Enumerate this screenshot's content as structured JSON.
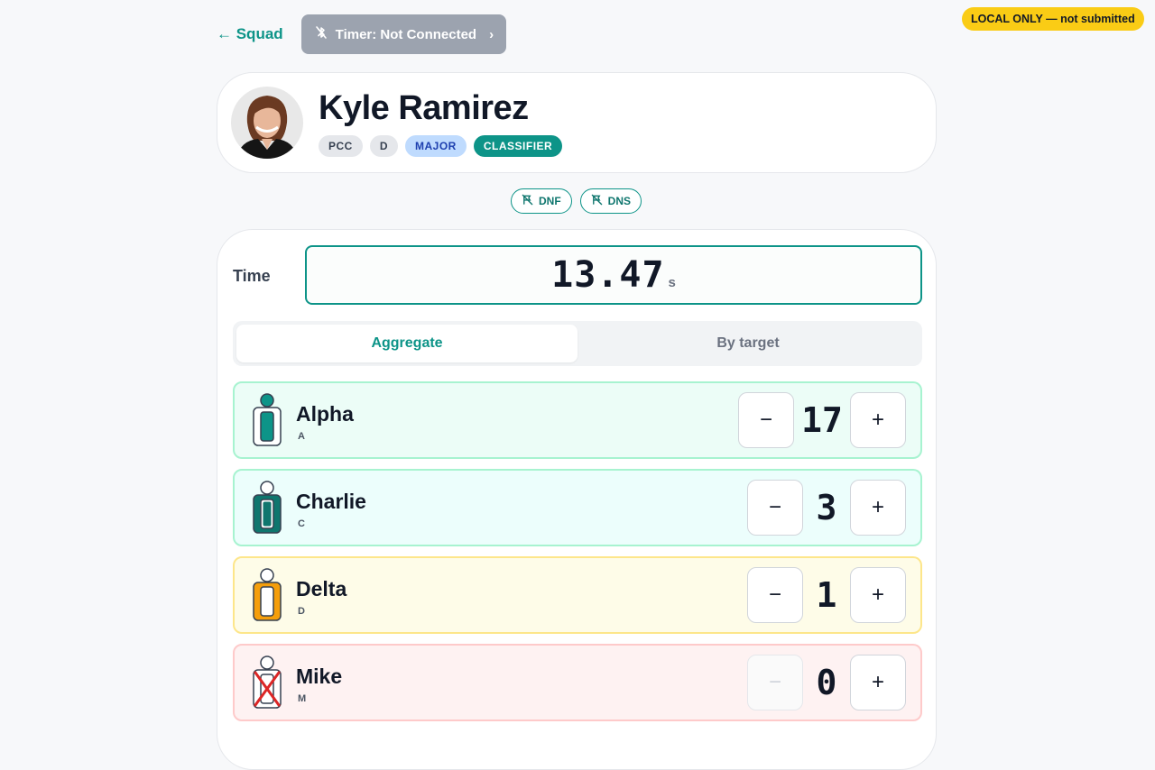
{
  "header": {
    "back_label": "← Squad",
    "timer_label": "Timer: Not Connected",
    "local_badge": "LOCAL ONLY — not submitted"
  },
  "shooter": {
    "name": "Kyle Ramirez",
    "tags": [
      "PCC",
      "D",
      "MAJOR",
      "CLASSIFIER"
    ]
  },
  "flags": {
    "dnf": "DNF",
    "dns": "DNS"
  },
  "time": {
    "label": "Time",
    "value": "13.47",
    "unit": "s"
  },
  "modes": {
    "aggregate": "Aggregate",
    "by_target": "By target",
    "active": "Aggregate"
  },
  "zones": [
    {
      "name": "Alpha",
      "code": "A",
      "count": "17",
      "color": "#0d9488"
    },
    {
      "name": "Charlie",
      "code": "C",
      "count": "3",
      "color": "#0f766e"
    },
    {
      "name": "Delta",
      "code": "D",
      "count": "1",
      "color": "#f59e0b"
    },
    {
      "name": "Mike",
      "code": "M",
      "count": "0",
      "color": "#dc2626"
    }
  ],
  "colors": {
    "accent": "#0d9488",
    "local_badge": "#facc15",
    "timer_disabled": "#9ca3af"
  }
}
